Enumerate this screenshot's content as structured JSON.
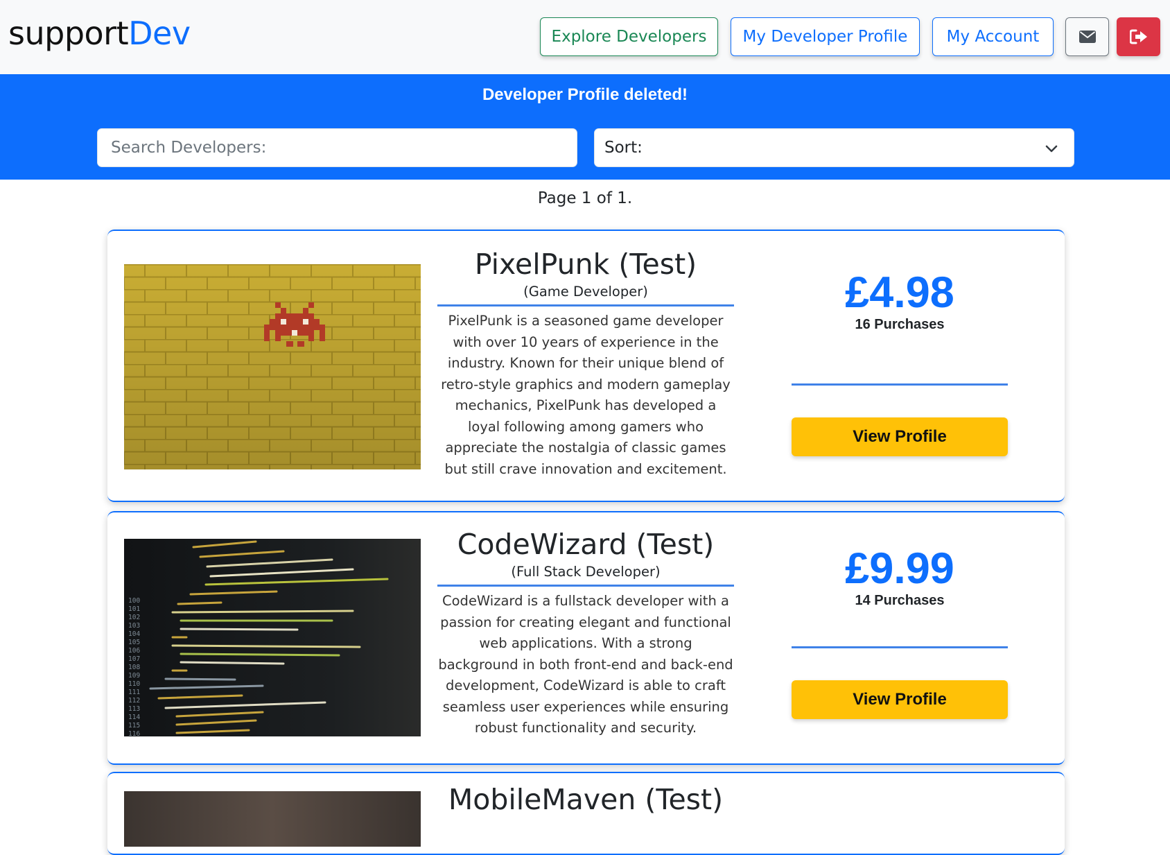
{
  "brand": {
    "part1": "support",
    "part2": "Dev"
  },
  "nav": {
    "explore": "Explore Developers",
    "dev_profile": "My Developer Profile",
    "account": "My Account",
    "mail_icon": "envelope-icon",
    "logout_icon": "sign-out-icon"
  },
  "alert": "Developer Profile deleted!",
  "search": {
    "placeholder": "Search Developers:"
  },
  "sort": {
    "label": "Sort:"
  },
  "pager": "Page 1 of 1.",
  "developers": [
    {
      "name": "PixelPunk (Test)",
      "role": "(Game Developer)",
      "bio": "PixelPunk is a seasoned game developer with over 10 years of experience in the industry. Known for their unique blend of retro-style graphics and modern gameplay mechanics, PixelPunk has developed a loyal following among gamers who appreciate the nostalgia of classic games but still crave innovation and excitement.",
      "price": "£4.98",
      "purchases": "16 Purchases",
      "button": "View Profile"
    },
    {
      "name": "CodeWizard (Test)",
      "role": "(Full Stack Developer)",
      "bio": "CodeWizard is a fullstack developer with a passion for creating elegant and functional web applications. With a strong background in both front-end and back-end development, CodeWizard is able to craft seamless user experiences while ensuring robust functionality and security.",
      "price": "£9.99",
      "purchases": "14 Purchases",
      "button": "View Profile"
    },
    {
      "name": "MobileMaven (Test)"
    }
  ],
  "colors": {
    "primary": "#0d6efd",
    "success": "#198754",
    "danger": "#dc3545",
    "warning": "#ffc107"
  }
}
